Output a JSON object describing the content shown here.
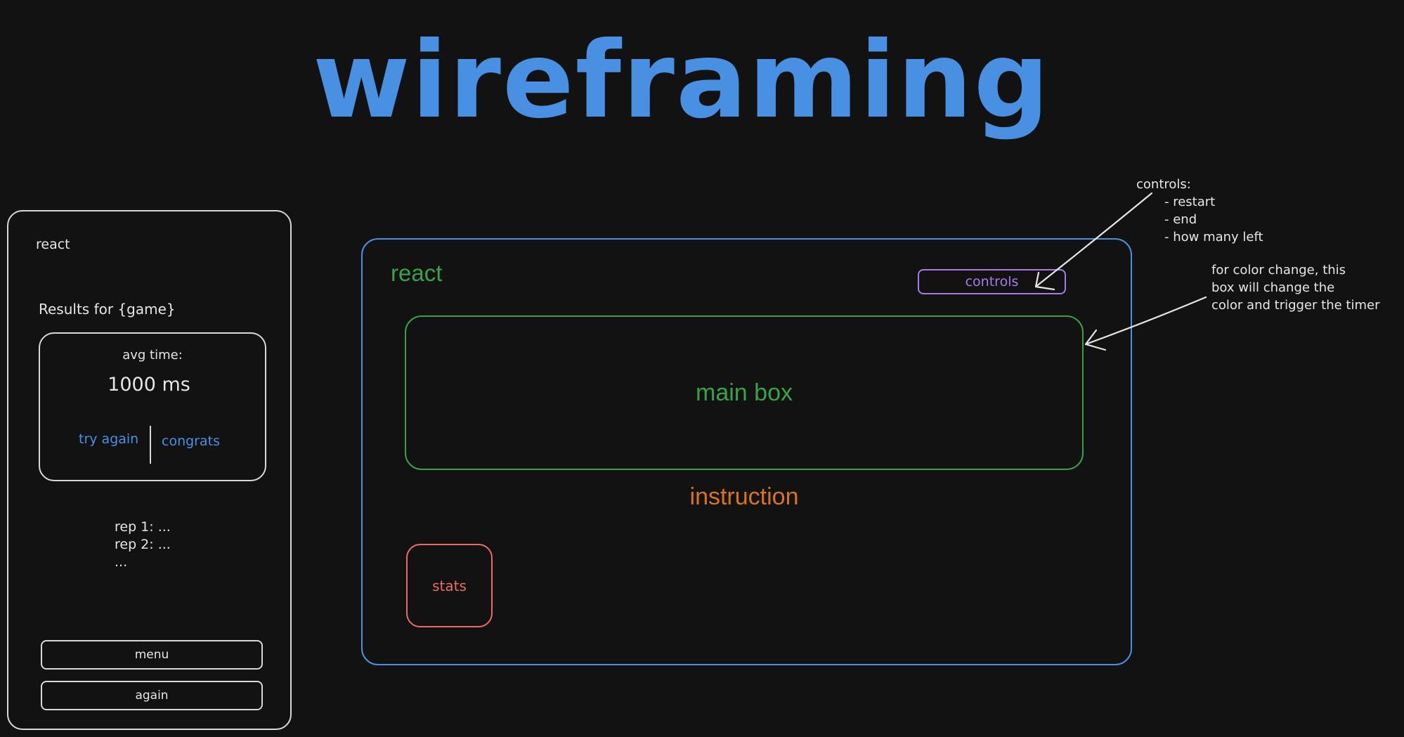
{
  "title": "wireframing",
  "mobile": {
    "header": "react",
    "results_title": "Results for {game}",
    "card": {
      "label": "avg time:",
      "value": "1000 ms",
      "left_action": "try again",
      "right_action": "congrats"
    },
    "reps": [
      "rep 1: ...",
      "rep 2: ...",
      "..."
    ],
    "buttons": {
      "menu": "menu",
      "again": "again"
    }
  },
  "desktop": {
    "header": "react",
    "controls": "controls",
    "main_box": "main box",
    "instruction": "instruction",
    "stats": "stats"
  },
  "annotations": {
    "controls_note": {
      "heading": "controls:",
      "items": [
        "- restart",
        "- end",
        "- how many left"
      ]
    },
    "color_note": [
      "for color change, this",
      "box will change the",
      "color and trigger the timer"
    ]
  },
  "colors": {
    "background": "#121212",
    "title": "#4a90e2",
    "desktop_frame": "#4a90e2",
    "main_box": "#3aa14a",
    "instruction": "#d9731f",
    "stats": "#ee6a6a",
    "controls": "#a779e9",
    "sketch": "#e6e6e6"
  }
}
